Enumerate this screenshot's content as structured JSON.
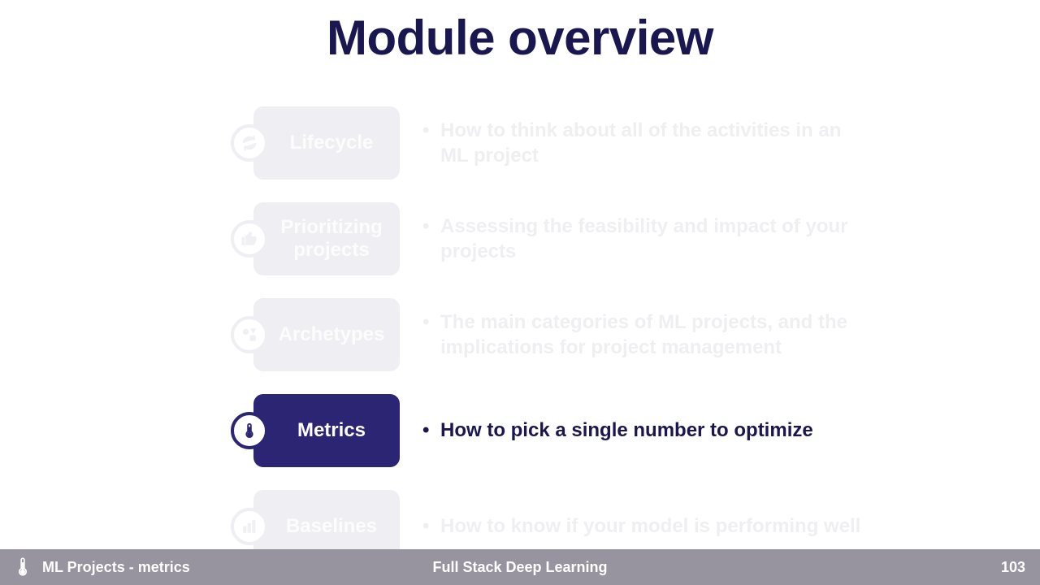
{
  "title": "Module overview",
  "sections": [
    {
      "label": "Lifecycle",
      "desc": "How to think about all of the activities in an ML project"
    },
    {
      "label": "Prioritizing\nprojects",
      "desc": "Assessing the feasibility and impact of your projects"
    },
    {
      "label": "Archetypes",
      "desc": "The main categories of ML projects, and the implications for project management"
    },
    {
      "label": "Metrics",
      "desc": "How to pick a single number to optimize"
    },
    {
      "label": "Baselines",
      "desc": "How to know if your model is performing well"
    }
  ],
  "footer": {
    "left": "ML Projects - metrics",
    "center": "Full Stack Deep Learning",
    "page": "103"
  }
}
